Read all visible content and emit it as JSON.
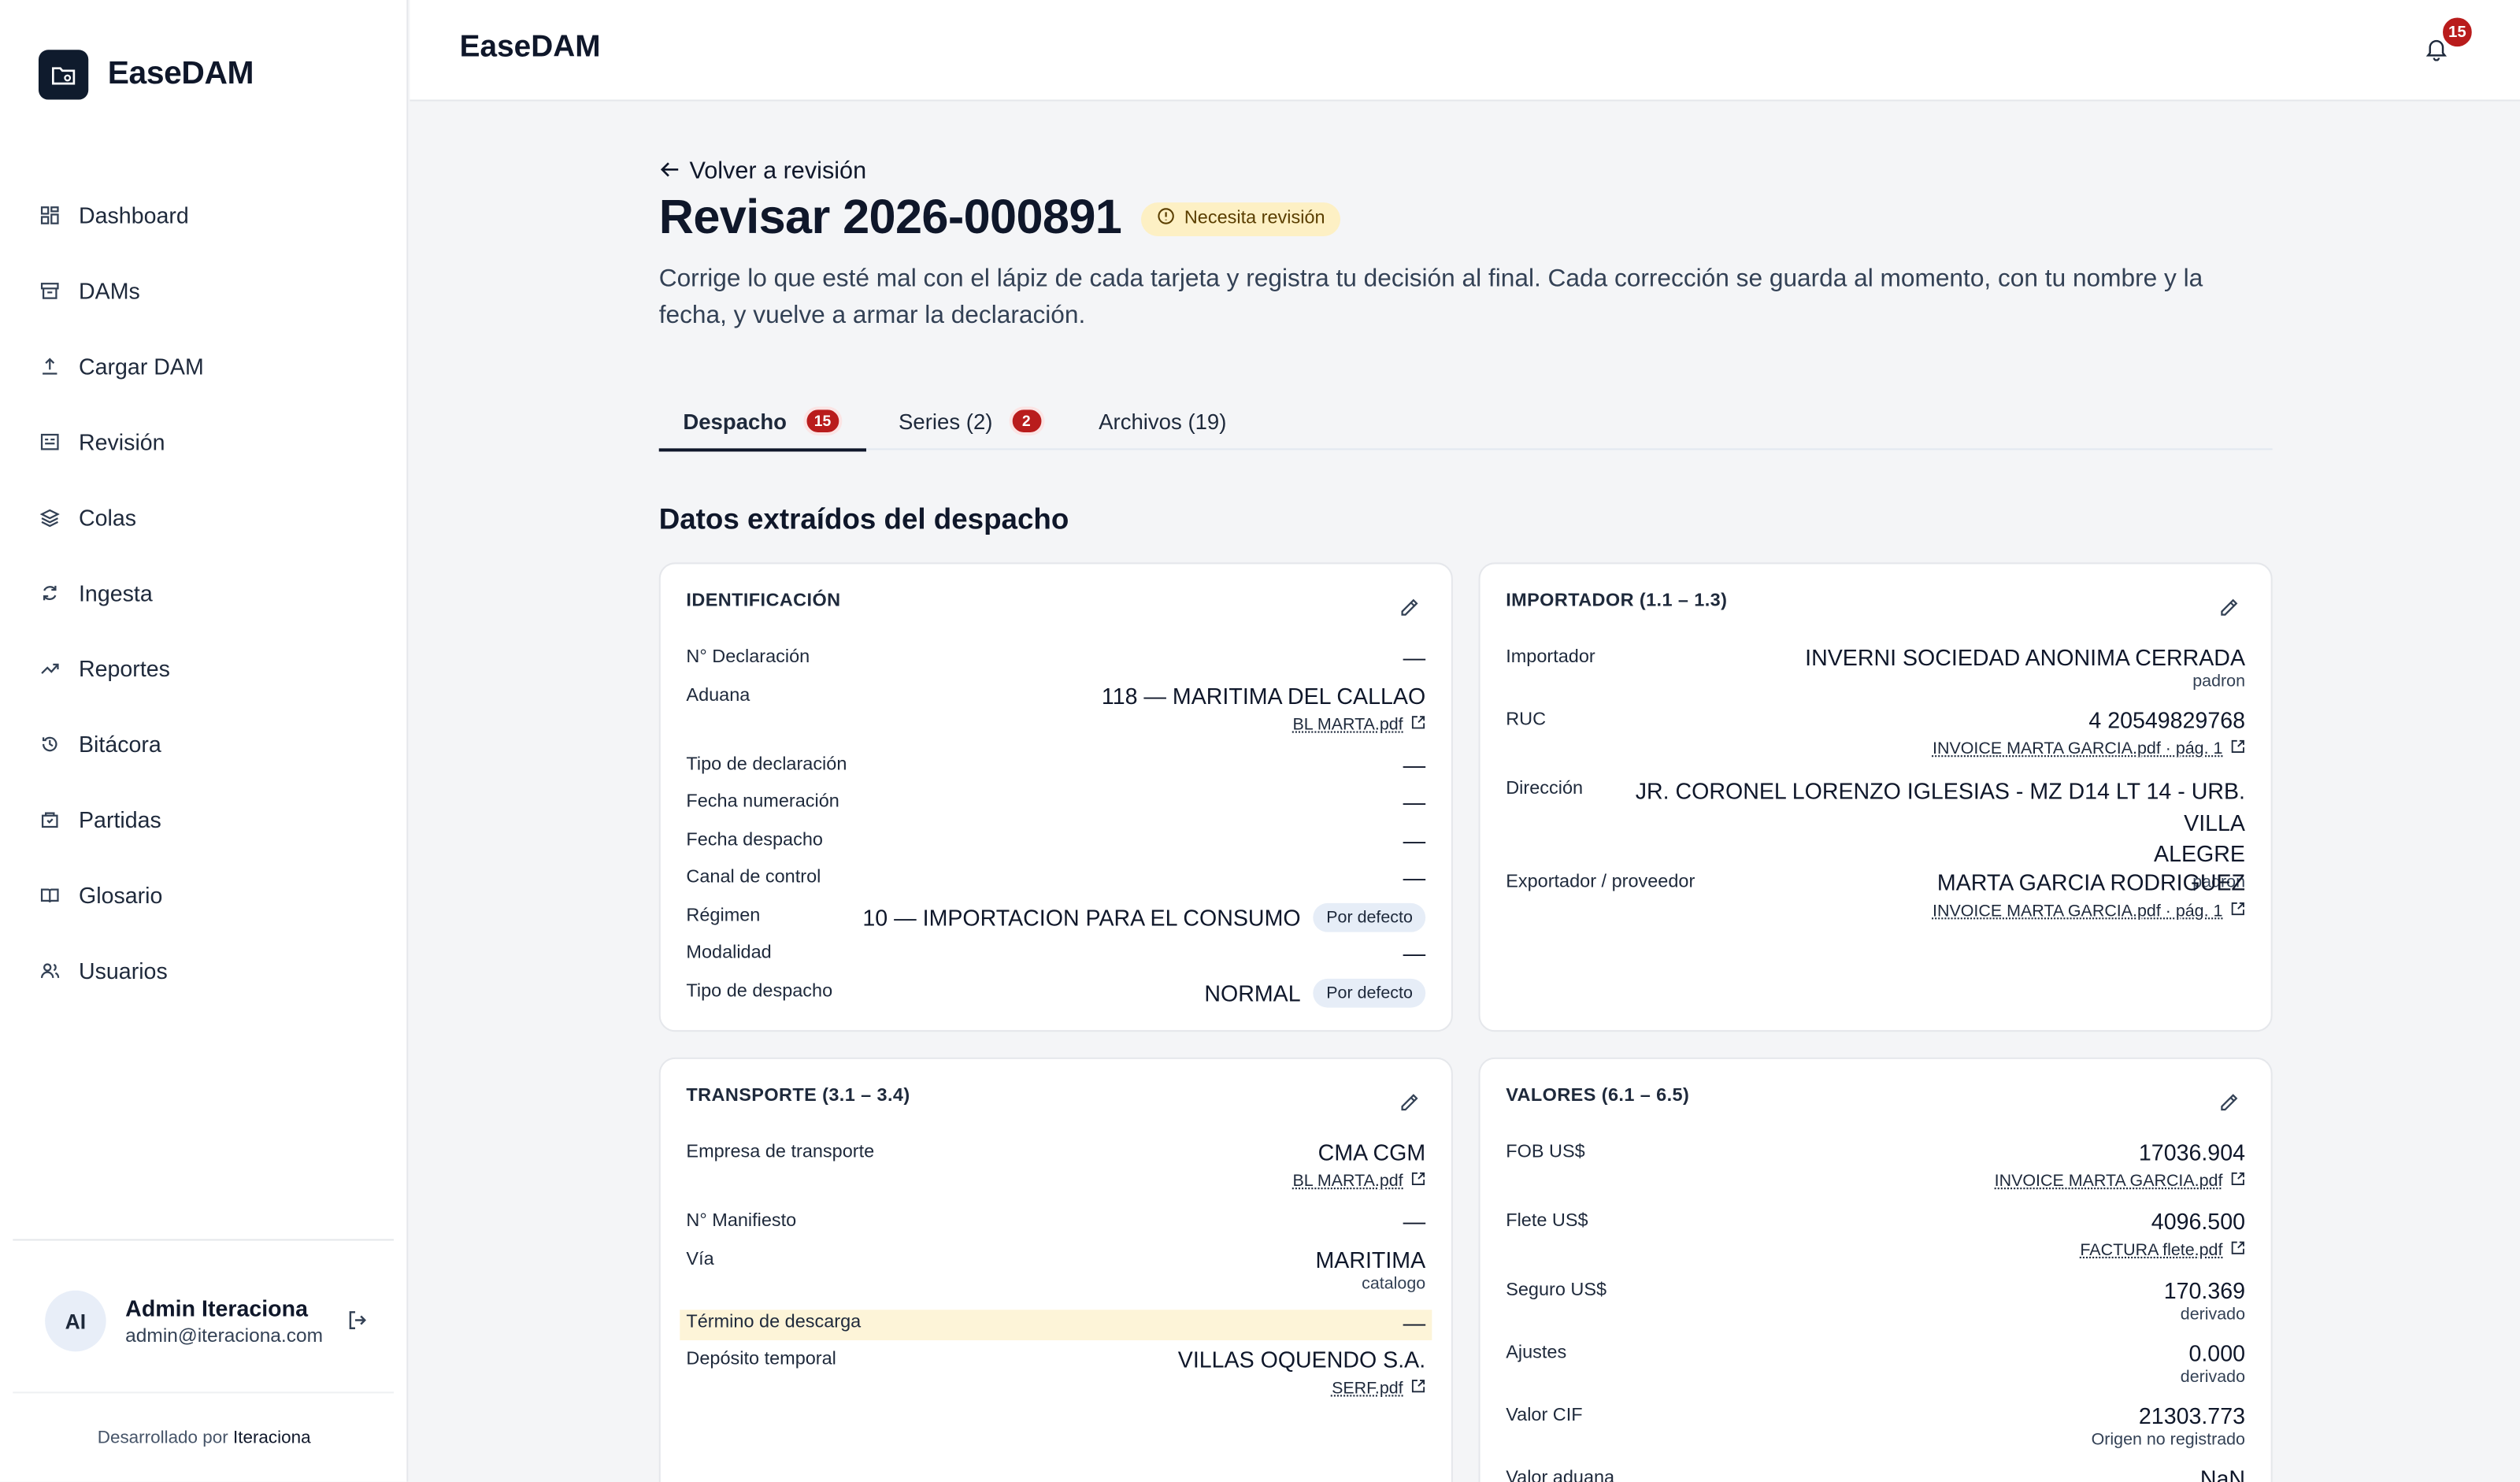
{
  "app": {
    "name": "EaseDAM",
    "header_title": "EaseDAM",
    "notification_count": "15"
  },
  "sidebar": {
    "items": [
      {
        "label": "Dashboard",
        "icon": "dashboard-icon"
      },
      {
        "label": "DAMs",
        "icon": "archive-icon"
      },
      {
        "label": "Cargar DAM",
        "icon": "upload-icon"
      },
      {
        "label": "Revisión",
        "icon": "review-icon"
      },
      {
        "label": "Colas",
        "icon": "layers-icon"
      },
      {
        "label": "Ingesta",
        "icon": "refresh-icon"
      },
      {
        "label": "Reportes",
        "icon": "trend-icon"
      },
      {
        "label": "Bitácora",
        "icon": "history-icon"
      },
      {
        "label": "Partidas",
        "icon": "package-icon"
      },
      {
        "label": "Glosario",
        "icon": "book-icon"
      },
      {
        "label": "Usuarios",
        "icon": "users-icon"
      }
    ],
    "user": {
      "initials": "AI",
      "name": "Admin Iteraciona",
      "email": "admin@iteraciona.com"
    },
    "credit_prefix": "Desarrollado por",
    "credit_brand": "Iteraciona"
  },
  "page": {
    "back_label": "Volver a revisión",
    "title": "Revisar 2026-000891",
    "status": "Necesita revisión",
    "lead": "Corrige lo que esté mal con el lápiz de cada tarjeta y registra tu decisión al final. Cada corrección se guarda al momento, con tu nombre y la fecha, y vuelve a armar la declaración.",
    "tabs": [
      {
        "label": "Despacho",
        "count": "15"
      },
      {
        "label": "Series (2)",
        "count": "2"
      },
      {
        "label": "Archivos (19)"
      }
    ],
    "section_title": "Datos extraídos del despacho"
  },
  "cards": {
    "identificacion": {
      "title": "IDENTIFICACIÓN",
      "rows": [
        {
          "label": "N° Declaración",
          "value": "—"
        },
        {
          "label": "Aduana",
          "value": "118 — MARITIMA DEL CALLAO",
          "link": "BL MARTA.pdf"
        },
        {
          "label": "Tipo de declaración",
          "value": "—"
        },
        {
          "label": "Fecha numeración",
          "value": "—"
        },
        {
          "label": "Fecha despacho",
          "value": "—"
        },
        {
          "label": "Canal de control",
          "value": "—"
        },
        {
          "label": "Régimen",
          "value": "10 — IMPORTACION PARA EL CONSUMO",
          "chip": "Por defecto"
        },
        {
          "label": "Modalidad",
          "value": "—"
        },
        {
          "label": "Tipo de despacho",
          "value": "NORMAL",
          "chip": "Por defecto"
        }
      ]
    },
    "importador": {
      "title": "IMPORTADOR (1.1 – 1.3)",
      "rows": [
        {
          "label": "Importador",
          "value": "INVERNI SOCIEDAD ANONIMA CERRADA",
          "sub": "padron"
        },
        {
          "label": "RUC",
          "value": "4 20549829768",
          "link": "INVOICE MARTA GARCIA.pdf · pág. 1"
        },
        {
          "label": "Dirección",
          "value_line1": "JR. CORONEL LORENZO IGLESIAS - MZ D14 LT 14 - URB. VILLA",
          "value_line2": "ALEGRE",
          "sub": "padron"
        },
        {
          "label": "Exportador / proveedor",
          "value": "MARTA GARCIA RODRIGUEZ",
          "link": "INVOICE MARTA GARCIA.pdf · pág. 1"
        }
      ]
    },
    "transporte": {
      "title": "TRANSPORTE (3.1 – 3.4)",
      "rows": [
        {
          "label": "Empresa de transporte",
          "value": "CMA CGM",
          "link": "BL MARTA.pdf"
        },
        {
          "label": "N° Manifiesto",
          "value": "—"
        },
        {
          "label": "Vía",
          "value": "MARITIMA",
          "sub": "catalogo"
        },
        {
          "label": "Término de descarga",
          "value": "—"
        },
        {
          "label": "Depósito temporal",
          "value": "VILLAS OQUENDO S.A.",
          "link": "SERF.pdf"
        }
      ]
    },
    "valores": {
      "title": "VALORES (6.1 – 6.5)",
      "rows": [
        {
          "label": "FOB US$",
          "value": "17036.904",
          "link": "INVOICE MARTA GARCIA.pdf"
        },
        {
          "label": "Flete US$",
          "value": "4096.500",
          "link": "FACTURA flete.pdf"
        },
        {
          "label": "Seguro US$",
          "value": "170.369",
          "sub": "derivado"
        },
        {
          "label": "Ajustes",
          "value": "0.000",
          "sub": "derivado"
        },
        {
          "label": "Valor CIF",
          "value": "21303.773",
          "sub": "Origen no registrado"
        },
        {
          "label": "Valor aduana",
          "value": "NaN"
        }
      ]
    }
  },
  "colors": {
    "accent": "#0f1b2d",
    "badge": "#b91c1c",
    "warning_bg": "#fdf0c4",
    "highlight_row": "#fdf4d8"
  }
}
